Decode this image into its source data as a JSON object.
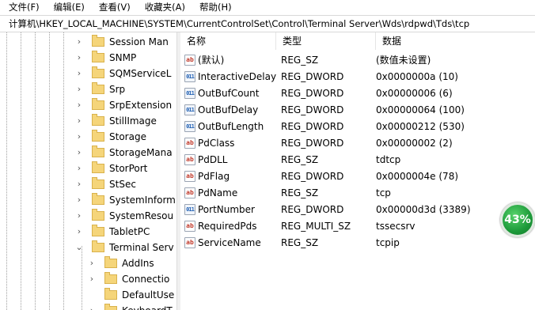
{
  "menu": [
    "文件(F)",
    "编辑(E)",
    "查看(V)",
    "收藏夹(A)",
    "帮助(H)"
  ],
  "address": "计算机\\HKEY_LOCAL_MACHINE\\SYSTEM\\CurrentControlSet\\Control\\Terminal Server\\Wds\\rdpwd\\Tds\\tcp",
  "tree": [
    {
      "label": "Session Man",
      "expander": "›"
    },
    {
      "label": "SNMP",
      "expander": "›"
    },
    {
      "label": "SQMServiceL",
      "expander": "›"
    },
    {
      "label": "Srp",
      "expander": "›"
    },
    {
      "label": "SrpExtension",
      "expander": "›"
    },
    {
      "label": "StillImage",
      "expander": "›"
    },
    {
      "label": "Storage",
      "expander": "›"
    },
    {
      "label": "StorageMana",
      "expander": "›"
    },
    {
      "label": "StorPort",
      "expander": "›"
    },
    {
      "label": "StSec",
      "expander": "›"
    },
    {
      "label": "SystemInform",
      "expander": "›"
    },
    {
      "label": "SystemResou",
      "expander": "›"
    },
    {
      "label": "TabletPC",
      "expander": "›"
    },
    {
      "label": "Terminal Serv",
      "expander": "⌄"
    },
    {
      "label": "AddIns",
      "expander": "›"
    },
    {
      "label": "Connectio",
      "expander": "›"
    },
    {
      "label": "DefaultUse",
      "expander": ""
    },
    {
      "label": "KeyboardT",
      "expander": "›"
    }
  ],
  "columns": {
    "name": "名称",
    "type": "类型",
    "data": "数据"
  },
  "values": [
    {
      "icon": "ab",
      "name": "(默认)",
      "type": "REG_SZ",
      "data": "(数值未设置)"
    },
    {
      "icon": "011",
      "name": "InteractiveDelay",
      "type": "REG_DWORD",
      "data": "0x0000000a (10)"
    },
    {
      "icon": "011",
      "name": "OutBufCount",
      "type": "REG_DWORD",
      "data": "0x00000006 (6)"
    },
    {
      "icon": "011",
      "name": "OutBufDelay",
      "type": "REG_DWORD",
      "data": "0x00000064 (100)"
    },
    {
      "icon": "011",
      "name": "OutBufLength",
      "type": "REG_DWORD",
      "data": "0x00000212 (530)"
    },
    {
      "icon": "ab",
      "name": "PdClass",
      "type": "REG_DWORD",
      "data": "0x00000002 (2)"
    },
    {
      "icon": "ab",
      "name": "PdDLL",
      "type": "REG_SZ",
      "data": "tdtcp"
    },
    {
      "icon": "ab",
      "name": "PdFlag",
      "type": "REG_DWORD",
      "data": "0x0000004e (78)"
    },
    {
      "icon": "ab",
      "name": "PdName",
      "type": "REG_SZ",
      "data": "tcp"
    },
    {
      "icon": "011",
      "name": "PortNumber",
      "type": "REG_DWORD",
      "data": "0x00000d3d (3389)"
    },
    {
      "icon": "ab",
      "name": "RequiredPds",
      "type": "REG_MULTI_SZ",
      "data": "tssecsrv"
    },
    {
      "icon": "ab",
      "name": "ServiceName",
      "type": "REG_SZ",
      "data": "tcpip"
    }
  ],
  "badge": "43%"
}
